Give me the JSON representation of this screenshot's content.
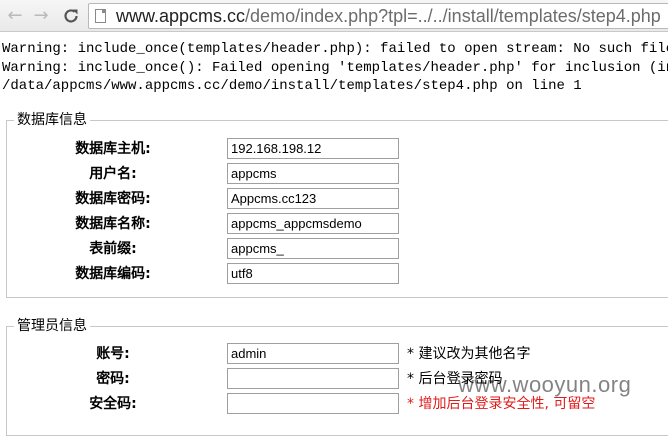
{
  "browser": {
    "back_icon": "←",
    "forward_icon": "→",
    "reload_icon": "C",
    "url_host": "www.appcms.cc",
    "url_path": "/demo/index.php?tpl=../../install/templates/step4.php"
  },
  "warnings": [
    "Warning: include_once(templates/header.php): failed to open stream: No such file or",
    "Warning: include_once(): Failed opening 'templates/header.php' for inclusion (inclu",
    "/data/appcms/www.appcms.cc/demo/install/templates/step4.php on line 1"
  ],
  "database": {
    "legend": "数据库信息",
    "rows": [
      {
        "label": "数据库主机:",
        "value": "192.168.198.12"
      },
      {
        "label": "用户名:",
        "value": "appcms"
      },
      {
        "label": "数据库密码:",
        "value": "Appcms.cc123"
      },
      {
        "label": "数据库名称:",
        "value": "appcms_appcmsdemo"
      },
      {
        "label": "表前缀:",
        "value": "appcms_"
      },
      {
        "label": "数据库编码:",
        "value": "utf8"
      }
    ]
  },
  "admin": {
    "legend": "管理员信息",
    "rows": [
      {
        "label": "账号:",
        "value": "admin",
        "note": "* 建议改为其他名字"
      },
      {
        "label": "密码:",
        "value": "",
        "note": "* 后台登录密码"
      },
      {
        "label": "安全码:",
        "value": "",
        "note": "* 增加后台登录安全性, 可留空"
      }
    ]
  },
  "watermark": "www.wooyun.org"
}
